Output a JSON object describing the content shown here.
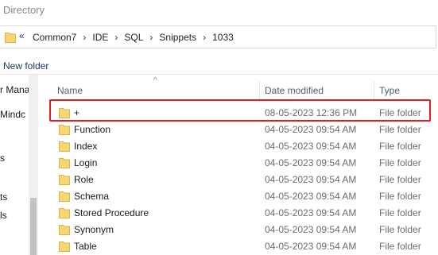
{
  "window": {
    "title": "Directory"
  },
  "address": {
    "chevron": "«",
    "separator": "›",
    "crumbs": [
      "Common7",
      "IDE",
      "SQL",
      "Snippets",
      "1033"
    ]
  },
  "toolbar": {
    "new_folder": "New folder"
  },
  "nav": {
    "items": [
      "r Mana",
      "Mindc",
      "s",
      "ts",
      "ls"
    ]
  },
  "columns": {
    "name": "Name",
    "date": "Date modified",
    "type": "Type"
  },
  "sort": {
    "column": "name",
    "glyph": "^"
  },
  "rows": [
    {
      "name": "+",
      "date": "08-05-2023 12:36 PM",
      "type": "File folder",
      "highlighted": true
    },
    {
      "name": "Function",
      "date": "04-05-2023 09:54 AM",
      "type": "File folder"
    },
    {
      "name": "Index",
      "date": "04-05-2023 09:54 AM",
      "type": "File folder"
    },
    {
      "name": "Login",
      "date": "04-05-2023 09:54 AM",
      "type": "File folder"
    },
    {
      "name": "Role",
      "date": "04-05-2023 09:54 AM",
      "type": "File folder"
    },
    {
      "name": "Schema",
      "date": "04-05-2023 09:54 AM",
      "type": "File folder"
    },
    {
      "name": "Stored Procedure",
      "date": "04-05-2023 09:54 AM",
      "type": "File folder"
    },
    {
      "name": "Synonym",
      "date": "04-05-2023 09:54 AM",
      "type": "File folder"
    },
    {
      "name": "Table",
      "date": "04-05-2023 09:54 AM",
      "type": "File folder"
    }
  ],
  "colors": {
    "folder": "#f7d774",
    "folder_edge": "#d9b44a",
    "highlight": "#e02020",
    "link": "#1b3a66"
  }
}
